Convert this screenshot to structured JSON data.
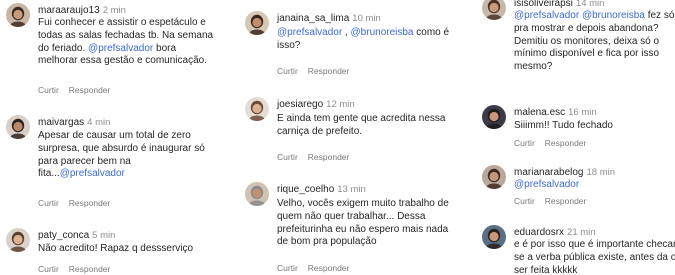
{
  "actions": {
    "like": "Curtir",
    "reply": "Responder"
  },
  "comments": [
    {
      "user": "maraaraujo13",
      "time": "2 min",
      "lines": [
        [
          {
            "t": "Fui conhecer e assistir o espetáculo e"
          }
        ],
        [
          {
            "t": "todas as salas fechadas tb. Na semana"
          }
        ],
        [
          {
            "t": "do feriado. "
          },
          {
            "t": "@prefsalvador",
            "m": true
          },
          {
            "t": " bora"
          }
        ],
        [
          {
            "t": "melhorar essa gestão e comunicação."
          }
        ]
      ]
    },
    {
      "user": "maivargas",
      "time": "4 min",
      "lines": [
        [
          {
            "t": "Apesar de causar um total de zero"
          }
        ],
        [
          {
            "t": "surpresa, que absurdo é inaugurar só"
          }
        ],
        [
          {
            "t": "para parecer bem na"
          }
        ],
        [
          {
            "t": "fita..."
          },
          {
            "t": "@prefsalvador",
            "m": true
          }
        ]
      ]
    },
    {
      "user": "paty_conca",
      "time": "5 min",
      "lines": [
        [
          {
            "t": "Não acredito! Rapaz q dessserviço"
          }
        ]
      ]
    },
    {
      "user": "janaina_sa_lima",
      "time": "10 min",
      "lines": [
        [
          {
            "t": "@prefsalvador",
            "m": true
          },
          {
            "t": " , "
          },
          {
            "t": "@brunoreisba",
            "m": true
          },
          {
            "t": " como é"
          }
        ],
        [
          {
            "t": "isso?"
          }
        ]
      ]
    },
    {
      "user": "joesiarego",
      "time": "12 min",
      "lines": [
        [
          {
            "t": "E ainda tem gente que acredita nessa"
          }
        ],
        [
          {
            "t": "carniça de prefeito."
          }
        ]
      ]
    },
    {
      "user": "rique_coelho",
      "time": "13 min",
      "lines": [
        [
          {
            "t": "Velho, vocês exigem muito trabalho de"
          }
        ],
        [
          {
            "t": "quem não quer trabalhar... Dessa"
          }
        ],
        [
          {
            "t": "prefeiturinha eu não espero mais nada"
          }
        ],
        [
          {
            "t": "de bom pra população"
          }
        ]
      ]
    },
    {
      "user": "isisoliveirapsi",
      "time": "14 min",
      "lines": [
        [
          {
            "t": "@prefsalvador",
            "m": true
          },
          {
            "t": " "
          },
          {
            "t": "@brunoreisba",
            "m": true
          },
          {
            "t": " fez só"
          }
        ],
        [
          {
            "t": "pra mostrar e depois abandona?"
          }
        ],
        [
          {
            "t": "Demitiu os monitores, deixa só o"
          }
        ],
        [
          {
            "t": "mínimo disponível e fica por isso"
          }
        ],
        [
          {
            "t": "mesmo?"
          }
        ]
      ]
    },
    {
      "user": "malena.esc",
      "time": "16 min",
      "lines": [
        [
          {
            "t": "Siiimm!! Tudo fechado"
          }
        ]
      ]
    },
    {
      "user": "marianarabelog",
      "time": "18 min",
      "lines": [
        [
          {
            "t": "@prefsalvador",
            "m": true
          }
        ]
      ]
    },
    {
      "user": "eduardosrx",
      "time": "21 min",
      "lines": [
        [
          {
            "t": "e é por isso que é importante checar"
          }
        ],
        [
          {
            "t": "se a verba pública existe, antes da obr"
          }
        ],
        [
          {
            "t": "ser feita kkkkk"
          }
        ]
      ]
    }
  ]
}
